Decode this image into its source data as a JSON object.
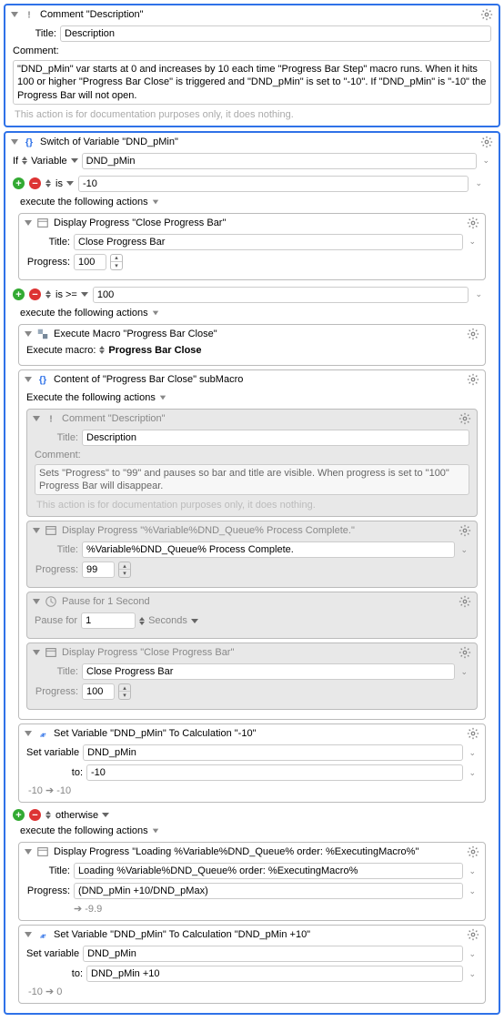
{
  "comment1": {
    "title_lbl": "Title:",
    "title_val": "Description",
    "header": "Comment \"Description\"",
    "comment_lbl": "Comment:",
    "text": "\"DND_pMin\" var starts at 0 and increases by 10 each time \"Progress Bar Step\" macro runs. When it hits 100 or higher \"Progress Bar Close\" is triggered and \"DND_pMin\" is set to \"-10\". If \"DND_pMin\" is \"-10\" the Progress Bar will not open.",
    "note": "This action is for documentation purposes only, it does nothing."
  },
  "switch": {
    "header": "Switch of Variable \"DND_pMin\"",
    "if_lbl": "If",
    "var_sel": "Variable",
    "var_name": "DND_pMin",
    "exec_lbl": "execute the following actions",
    "cases": {
      "c1": {
        "op": "is",
        "val": "-10"
      },
      "c2": {
        "op": "is >=",
        "val": "100"
      },
      "c3": {
        "op": "otherwise"
      }
    }
  },
  "dp_close": {
    "header": "Display Progress \"Close Progress Bar\"",
    "title_lbl": "Title:",
    "title_val": "Close Progress Bar",
    "prog_lbl": "Progress:",
    "prog_val": "100"
  },
  "exec_macro": {
    "header": "Execute Macro \"Progress Bar Close\"",
    "lbl": "Execute macro:",
    "name": "Progress Bar Close"
  },
  "submacro": {
    "header": "Content of \"Progress Bar Close\" subMacro",
    "exec_lbl": "Execute the following actions"
  },
  "comment2": {
    "header": "Comment \"Description\"",
    "title_lbl": "Title:",
    "title_val": "Description",
    "comment_lbl": "Comment:",
    "text": "Sets \"Progress\" to \"99\" and pauses so bar and title are visible. When progress is set to \"100\" Progress Bar will disappear.",
    "note": "This action is for documentation purposes only, it does nothing."
  },
  "dp_complete": {
    "header": "Display Progress \"%Variable%DND_Queue% Process Complete.\"",
    "title_lbl": "Title:",
    "title_val": "%Variable%DND_Queue% Process Complete.",
    "prog_lbl": "Progress:",
    "prog_val": "99"
  },
  "pause": {
    "header": "Pause for 1 Second",
    "lbl": "Pause for",
    "val": "1",
    "unit": "Seconds"
  },
  "dp_close2": {
    "header": "Display Progress \"Close Progress Bar\"",
    "title_lbl": "Title:",
    "title_val": "Close Progress Bar",
    "prog_lbl": "Progress:",
    "prog_val": "100"
  },
  "setvar1": {
    "header": "Set Variable \"DND_pMin\" To Calculation \"-10\"",
    "lbl1": "Set variable",
    "var": "DND_pMin",
    "lbl2": "to:",
    "val": "-10",
    "result": "-10 ➔ -10"
  },
  "dp_loading": {
    "header": "Display Progress \"Loading %Variable%DND_Queue% order: %ExecutingMacro%\"",
    "title_lbl": "Title:",
    "title_val": "Loading %Variable%DND_Queue% order: %ExecutingMacro%",
    "prog_lbl": "Progress:",
    "prog_val": "(DND_pMin +10/DND_pMax)",
    "result": "➔ -9.9"
  },
  "setvar2": {
    "header": "Set Variable \"DND_pMin\" To Calculation \"DND_pMin +10\"",
    "lbl1": "Set variable",
    "var": "DND_pMin",
    "lbl2": "to:",
    "val": "DND_pMin +10",
    "result": "-10 ➔ 0"
  }
}
